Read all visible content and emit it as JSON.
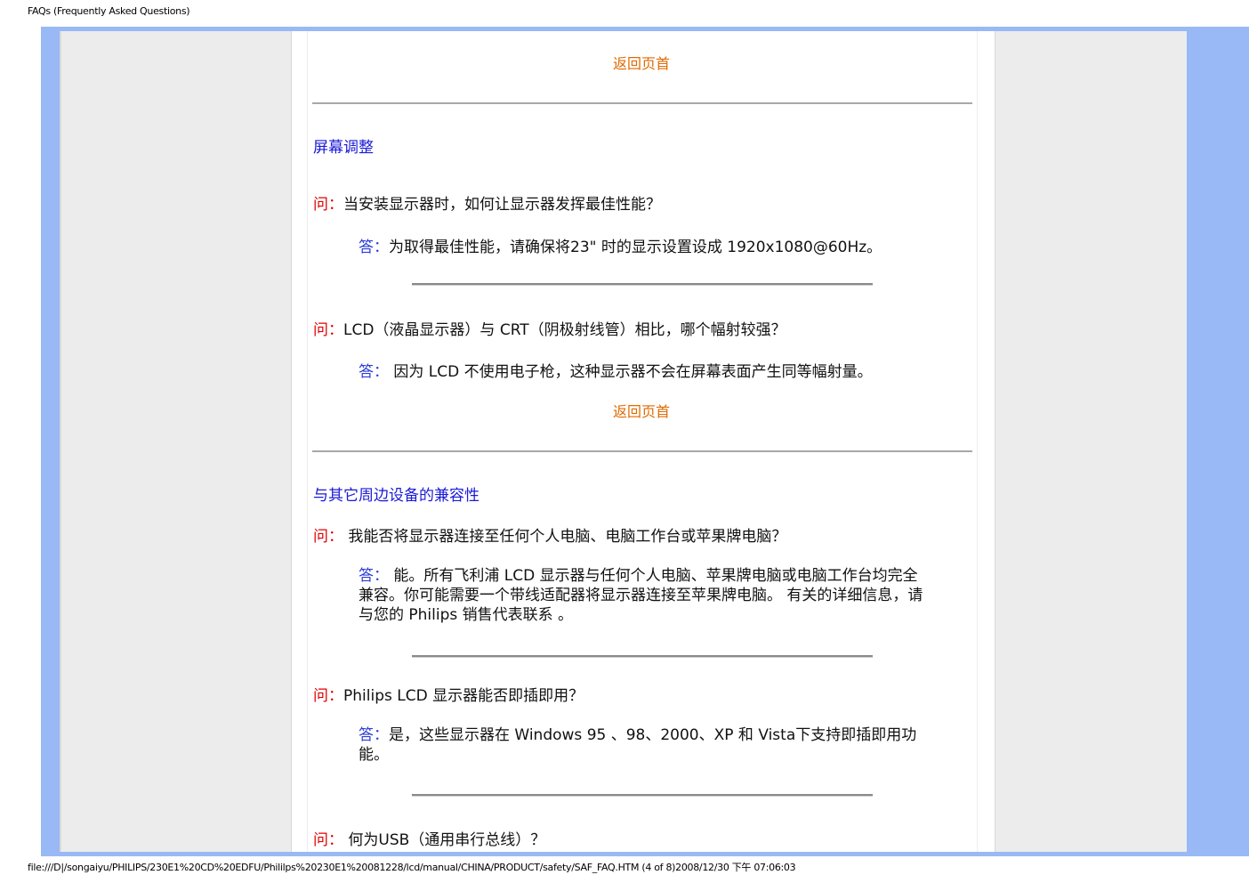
{
  "print_header": "FAQs (Frequently Asked Questions)",
  "print_footer": "file:///D|/songaiyu/PHILIPS/230E1%20CD%20EDFU/Phililps%20230E1%20081228/lcd/manual/CHINA/PRODUCT/safety/SAF_FAQ.HTM (4 of 8)2008/12/30 下午 07:06:03",
  "top_link_label": "返回页首",
  "sections": [
    {
      "title": "屏幕调整",
      "qa": [
        {
          "q_marker": "问：",
          "question": "当安装显示器时，如何让显示器发挥最佳性能？",
          "a_marker": "答：",
          "answer": "为取得最佳性能，请确保将23\" 时的显示设置设成 1920x1080@60Hz。"
        },
        {
          "q_marker": "问：",
          "question": "LCD（液晶显示器）与 CRT（阴极射线管）相比，哪个幅射较强？",
          "a_marker": "答：",
          "answer": "因为 LCD 不使用电子枪，这种显示器不会在屏幕表面产生同等幅射量。"
        }
      ]
    },
    {
      "title": "与其它周边设备的兼容性",
      "qa": [
        {
          "q_marker": "问：",
          "question": "我能否将显示器连接至任何个人电脑、电脑工作台或苹果牌电脑？",
          "a_marker": "答：",
          "answer": "能。所有飞利浦 LCD 显示器与任何个人电脑、苹果牌电脑或电脑工作台均完全兼容。你可能需要一个带线适配器将显示器连接至苹果牌电脑。 有关的详细信息，请与您的 Philips 销售代表联系 。"
        },
        {
          "q_marker": "问：",
          "question": "Philips LCD 显示器能否即插即用？",
          "a_marker": "答：",
          "answer": "是，这些显示器在 Windows 95 、98、2000、XP 和 Vista下支持即插即用功能。"
        },
        {
          "q_marker": "问：",
          "question": "何为USB（通用串行总线）？"
        }
      ]
    }
  ]
}
